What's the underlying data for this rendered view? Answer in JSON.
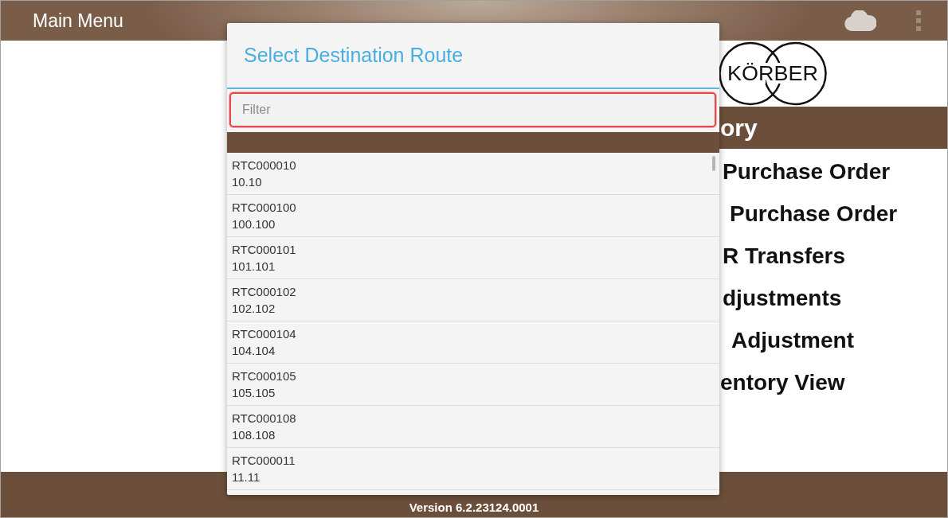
{
  "top_bar": {
    "title": "Main Menu"
  },
  "logo": {
    "text": "KÖRBER"
  },
  "section": {
    "title": "ory"
  },
  "menu_items": [
    "Purchase Order",
    "Purchase Order",
    "R Transfers",
    "djustments",
    "Adjustment",
    "entory View"
  ],
  "dialog": {
    "title": "Select Destination Route",
    "filter": {
      "placeholder": "Filter",
      "highlighted": true
    },
    "routes": [
      {
        "code": "RTC000010",
        "name": "10.10"
      },
      {
        "code": "RTC000100",
        "name": "100.100"
      },
      {
        "code": "RTC000101",
        "name": "101.101"
      },
      {
        "code": "RTC000102",
        "name": "102.102"
      },
      {
        "code": "RTC000104",
        "name": "104.104"
      },
      {
        "code": "RTC000105",
        "name": "105.105"
      },
      {
        "code": "RTC000108",
        "name": "108.108"
      },
      {
        "code": "RTC000011",
        "name": "11.11"
      }
    ]
  },
  "footer": {
    "version": "Version 6.2.23124.0001"
  }
}
